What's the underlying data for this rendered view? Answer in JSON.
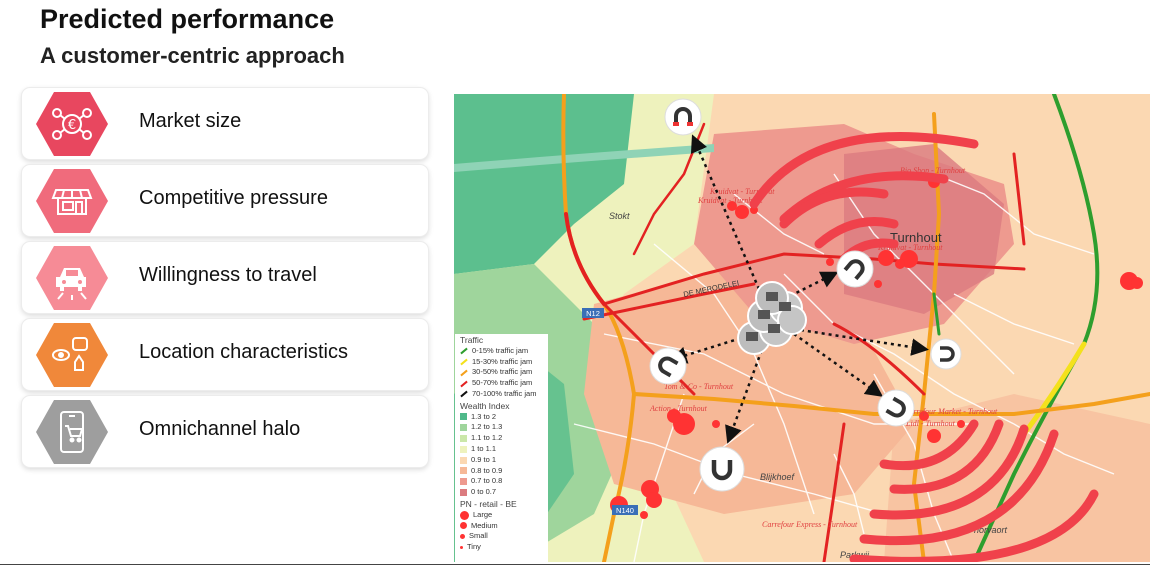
{
  "header": {
    "title": "Predicted performance",
    "subtitle": "A customer-centric approach"
  },
  "factors": [
    {
      "label": "Market size",
      "icon": "euro-network-icon",
      "color": "#e8475f"
    },
    {
      "label": "Competitive pressure",
      "icon": "storefront-icon",
      "color": "#f06b7c"
    },
    {
      "label": "Willingness to travel",
      "icon": "car-road-icon",
      "color": "#f68b96"
    },
    {
      "label": "Location characteristics",
      "icon": "location-cluster-icon",
      "color": "#f0883a"
    },
    {
      "label": "Omnichannel halo",
      "icon": "smartphone-cart-icon",
      "color": "#9e9e9e"
    }
  ],
  "map": {
    "place_labels": {
      "town": "Turnhout",
      "stokt": "Stokt",
      "blijkhoef": "Blijkhoef",
      "horvaort": "horvaort",
      "parkwijk": "Parkwij",
      "road_de_merode": "DE MERODELEI",
      "road_n12": "N12",
      "road_n140": "N140"
    },
    "store_labels": [
      "Kruidvat - Turnhout",
      "Kruidvat - Turnhout",
      "Kruidvat - Turnhout",
      "Bio Shop - Turnhout",
      "Action - Turnhout",
      "Tom & Co - Turnhout",
      "Carrefour Market - Turnhout",
      "Lidl - Turnhout",
      "Carrefour Express - Turnhout"
    ]
  },
  "legend": {
    "traffic_title": "Traffic",
    "traffic_items": [
      {
        "label": "0-15% traffic jam",
        "color": "#2e9e2e"
      },
      {
        "label": "15-30% traffic jam",
        "color": "#f4e11c"
      },
      {
        "label": "30-50% traffic jam",
        "color": "#f4a01c"
      },
      {
        "label": "50-70% traffic jam",
        "color": "#e32222"
      },
      {
        "label": "70-100% traffic jam",
        "color": "#111111"
      }
    ],
    "wealth_title": "Wealth Index",
    "wealth_items": [
      {
        "label": "1.3 to 2",
        "color": "#4fb98a"
      },
      {
        "label": "1.2 to 1.3",
        "color": "#9fd59c"
      },
      {
        "label": "1.1 to 1.2",
        "color": "#cbe7a9"
      },
      {
        "label": "1 to 1.1",
        "color": "#eef2bd"
      },
      {
        "label": "0.9 to 1",
        "color": "#fbd8b2"
      },
      {
        "label": "0.8 to 0.9",
        "color": "#f6b897"
      },
      {
        "label": "0.7 to 0.8",
        "color": "#ee9a8f"
      },
      {
        "label": "0 to 0.7",
        "color": "#db7b7f"
      }
    ],
    "retail_title": "PN - retail - BE",
    "retail_items": [
      {
        "label": "Large"
      },
      {
        "label": "Medium"
      },
      {
        "label": "Small"
      },
      {
        "label": "Tiny"
      }
    ]
  }
}
